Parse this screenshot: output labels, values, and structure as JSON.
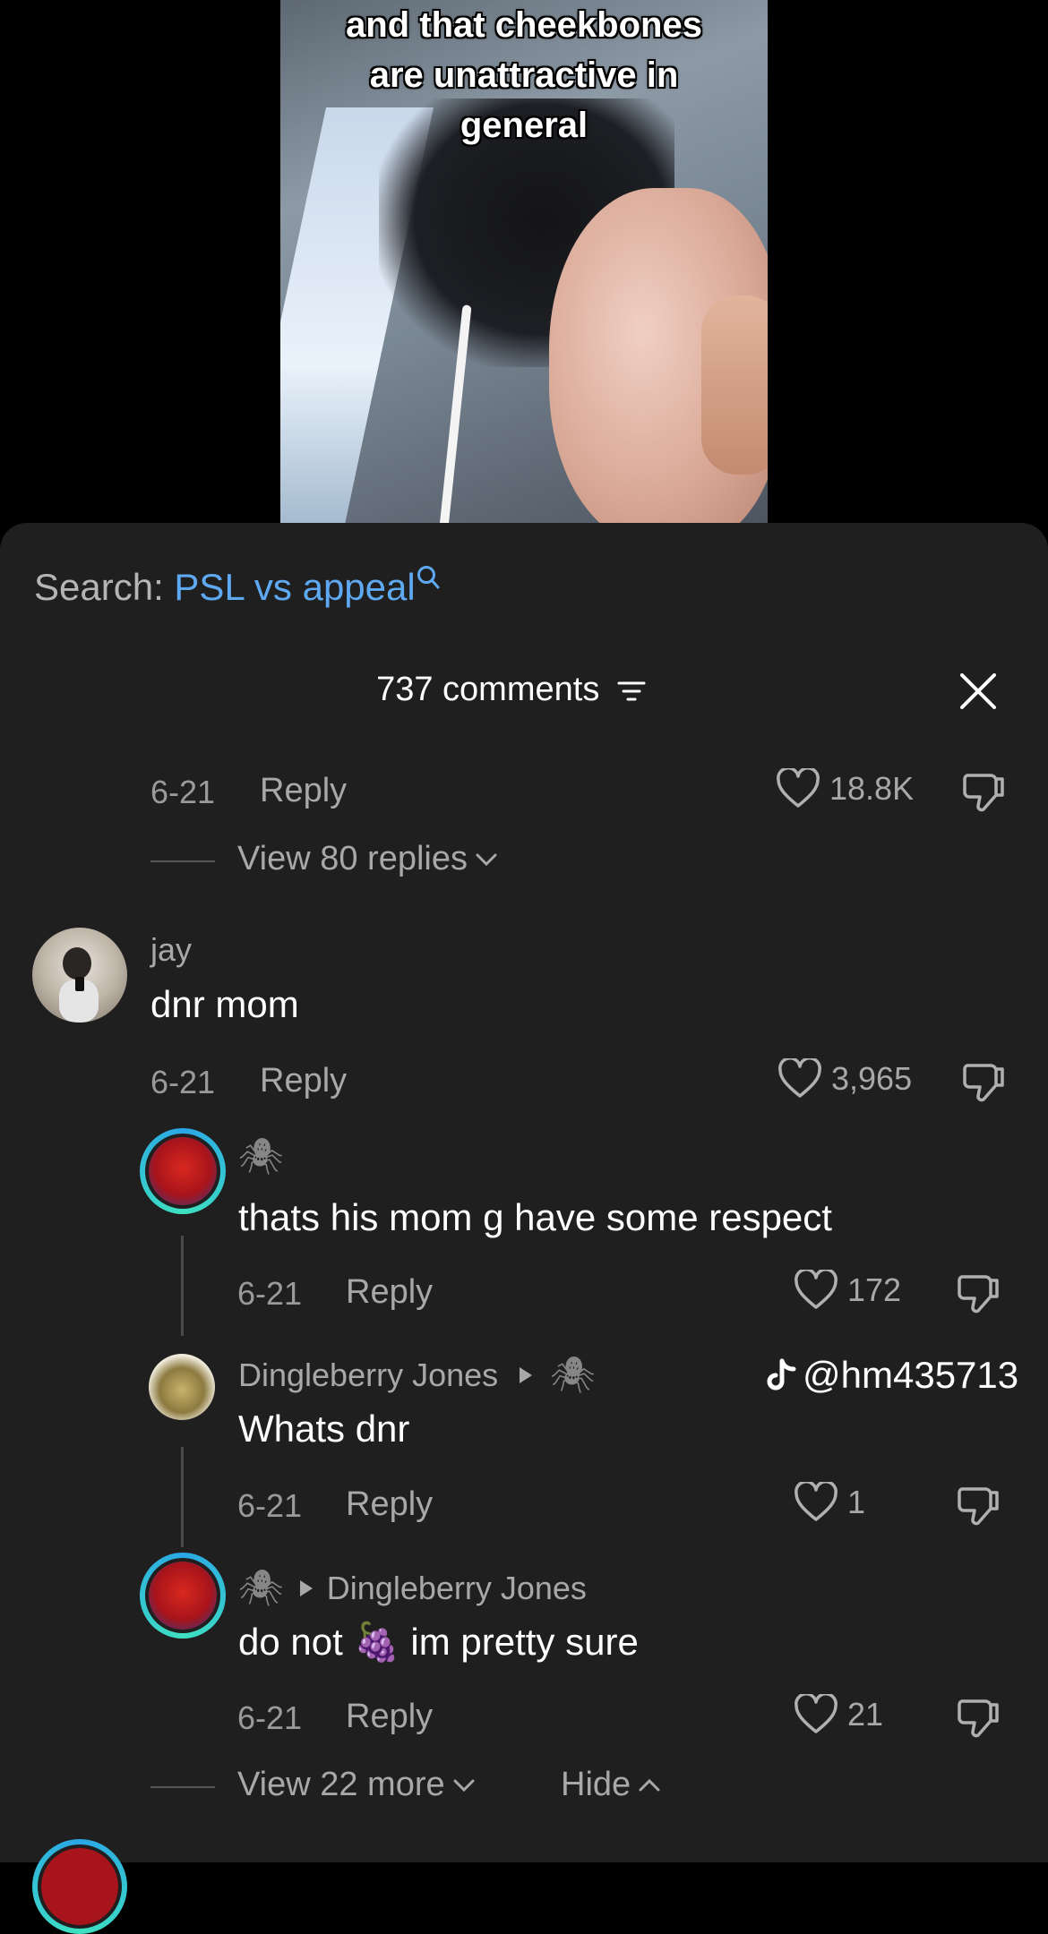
{
  "video": {
    "caption_lines": [
      "and that cheekbones",
      "are unattractive in",
      "general"
    ]
  },
  "search": {
    "prefix": "Search: ",
    "term": "PSL vs appeal"
  },
  "comments_header": {
    "count_label": "737 comments"
  },
  "top_comment": {
    "date": "6-21",
    "reply_label": "Reply",
    "likes": "18.8K",
    "view_replies": "View 80 replies"
  },
  "comment_jay": {
    "username": "jay",
    "text": "dnr mom",
    "date": "6-21",
    "reply_label": "Reply",
    "likes": "3,965"
  },
  "replies": [
    {
      "username": "🕷",
      "text": "thats his mom g have some respect",
      "date": "6-21",
      "reply_label": "Reply",
      "likes": "172"
    },
    {
      "username": "Dingleberry Jones",
      "reply_to": "🕷",
      "text": "Whats dnr",
      "date": "6-21",
      "reply_label": "Reply",
      "likes": "1"
    },
    {
      "username": "🕷",
      "reply_to": "Dingleberry Jones",
      "text": "do not 🍇 im pretty sure",
      "date": "6-21",
      "reply_label": "Reply",
      "likes": "21"
    }
  ],
  "footer": {
    "view_more": "View 22 more",
    "hide": "Hide"
  },
  "watermark": {
    "handle": "@hm435713"
  },
  "colors": {
    "sheet_bg": "#1f1f1f",
    "search_term": "#5ea9f2",
    "secondary_text": "#a8a8a8",
    "avatar_ring_a": "#2aa7e6",
    "avatar_ring_b": "#3ee0c0"
  },
  "icons": [
    "search-icon",
    "sort-icon",
    "close-icon",
    "heart-icon",
    "dislike-icon",
    "chevron-down-icon",
    "chevron-up-icon",
    "play-triangle-icon",
    "tiktok-logo-icon"
  ]
}
